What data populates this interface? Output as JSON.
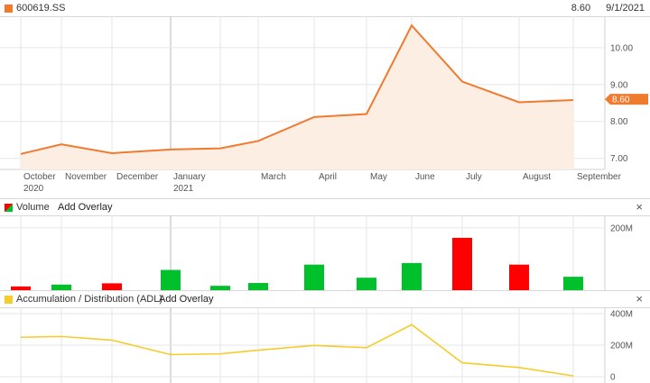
{
  "price_panel": {
    "symbol": "600619.SS",
    "last_price": "8.60",
    "date": "9/1/2021",
    "marker_label": "8.60",
    "color": "#f07a2e"
  },
  "volume_panel": {
    "title": "Volume",
    "add_overlay": "Add Overlay",
    "close": "×",
    "up_color": "#00c02c",
    "down_color": "#ff0000"
  },
  "adl_panel": {
    "title": "Accumulation / Distribution (ADL)",
    "add_overlay": "Add Overlay",
    "close": "×",
    "color": "#f5cc2a"
  },
  "chart_data": [
    {
      "type": "area",
      "x": [
        "2020-09",
        "2020-10",
        "2020-11",
        "2020-12",
        "2021-01",
        "2021-02",
        "2021-03",
        "2021-04",
        "2021-05",
        "2021-06",
        "2021-07",
        "2021-08",
        "2021-09"
      ],
      "values": [
        7.12,
        7.38,
        7.14,
        7.24,
        7.27,
        7.47,
        8.12,
        8.2,
        10.6,
        9.08,
        8.52,
        8.58,
        8.6
      ],
      "ylim": [
        6.7,
        10.85
      ],
      "yticks": [
        "7.00",
        "8.00",
        "9.00",
        "10.00"
      ],
      "xlabels": [
        {
          "line1": "October",
          "line2": "2020"
        },
        {
          "line1": "November",
          "line2": ""
        },
        {
          "line1": "December",
          "line2": ""
        },
        {
          "line1": "January",
          "line2": "2021"
        },
        {
          "line1": "March",
          "line2": ""
        },
        {
          "line1": "April",
          "line2": ""
        },
        {
          "line1": "May",
          "line2": ""
        },
        {
          "line1": "June",
          "line2": ""
        },
        {
          "line1": "July",
          "line2": ""
        },
        {
          "line1": "August",
          "line2": ""
        },
        {
          "line1": "September",
          "line2": ""
        }
      ]
    },
    {
      "type": "bar",
      "x": [
        "2020-09",
        "2020-10",
        "2020-11",
        "2020-12",
        "2021-01",
        "2021-02",
        "2021-03",
        "2021-04",
        "2021-05",
        "2021-06",
        "2021-07",
        "2021-08",
        "2021-09"
      ],
      "values": [
        12,
        18,
        22,
        65,
        14,
        23,
        82,
        40,
        87,
        168,
        82,
        43,
        0
      ],
      "direction": [
        "down",
        "up",
        "down",
        "up",
        "up",
        "up",
        "up",
        "up",
        "up",
        "down",
        "down",
        "up",
        "up"
      ],
      "unit": "M",
      "ylim": [
        0,
        240
      ],
      "yticks": [
        "200M"
      ]
    },
    {
      "type": "line",
      "x": [
        "2020-09",
        "2020-10",
        "2020-11",
        "2020-12",
        "2021-01",
        "2021-02",
        "2021-03",
        "2021-04",
        "2021-05",
        "2021-06",
        "2021-07",
        "2021-08",
        "2021-09"
      ],
      "values": [
        250,
        255,
        232,
        140,
        145,
        168,
        198,
        184,
        330,
        88,
        58,
        5,
        0
      ],
      "unit": "M",
      "ylim": [
        -40,
        440
      ],
      "yticks": [
        "400M",
        "200M",
        "0"
      ]
    }
  ]
}
